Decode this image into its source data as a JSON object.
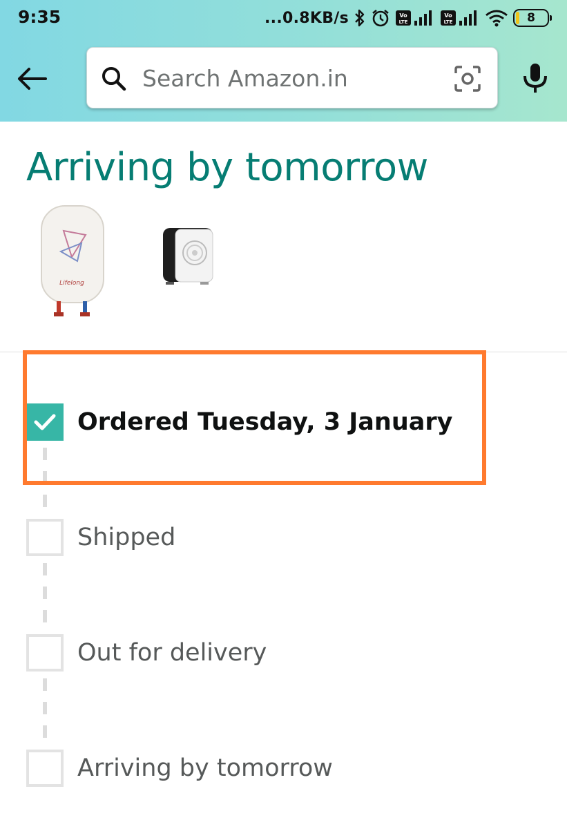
{
  "status_bar": {
    "time": "9:35",
    "net_speed": "...0.8KB/s",
    "battery": "8",
    "sim1_label": "Vo LTE",
    "sim2_label": "Vo LTE"
  },
  "search": {
    "placeholder": "Search Amazon.in"
  },
  "shipment": {
    "title": "Arriving by tomorrow",
    "products": [
      {
        "name": "water-heater",
        "brand_text": "Lifelong"
      },
      {
        "name": "fan-heater"
      }
    ]
  },
  "timeline": {
    "steps": [
      {
        "label": "Ordered Tuesday, 3 January",
        "completed": true
      },
      {
        "label": "Shipped",
        "completed": false
      },
      {
        "label": "Out for delivery",
        "completed": false
      },
      {
        "label": "Arriving by tomorrow",
        "completed": false
      }
    ]
  },
  "colors": {
    "title_teal": "#067d73",
    "check_teal": "#37b6a6",
    "highlight_orange": "#ff7a2e",
    "header_gradient_start": "#82d8e3",
    "header_gradient_end": "#a6e6ce"
  },
  "icons": [
    "back-arrow-icon",
    "search-icon",
    "camera-icon",
    "mic-icon",
    "checkmark-icon",
    "bluetooth-icon",
    "alarm-icon",
    "signal-icon",
    "wifi-icon",
    "battery-icon"
  ]
}
